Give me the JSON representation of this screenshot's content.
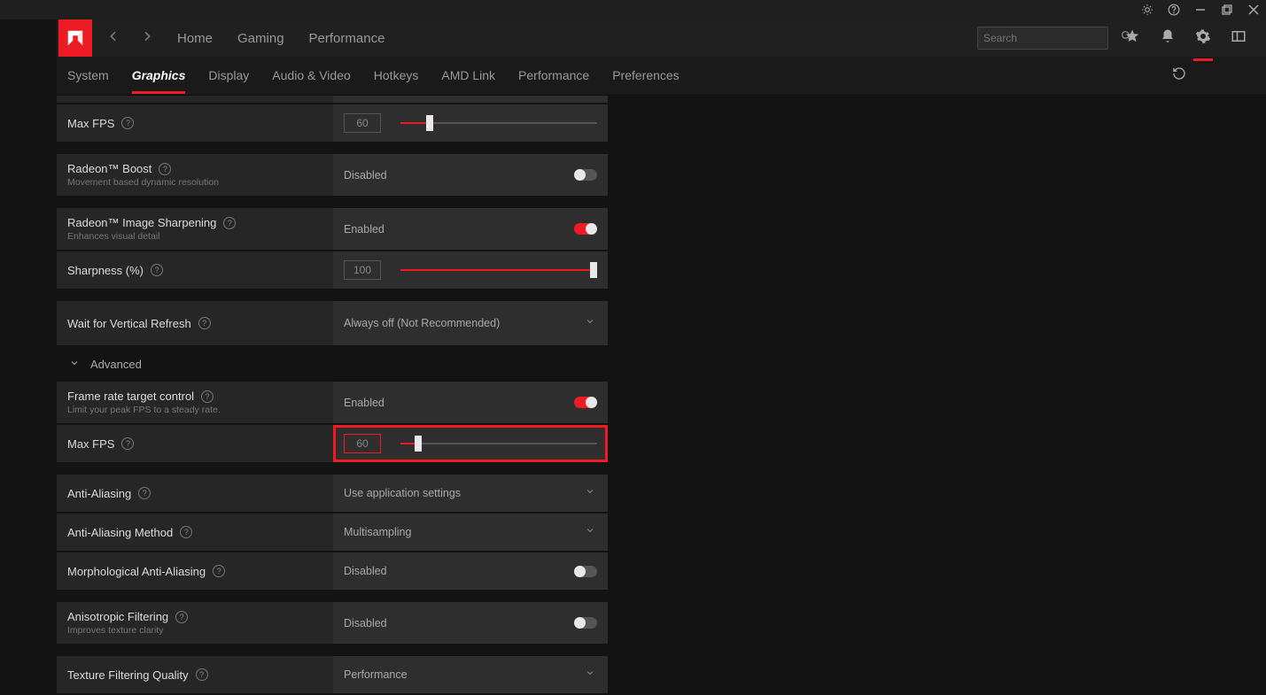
{
  "titlebar": {},
  "header": {
    "nav": {
      "home": "Home",
      "gaming": "Gaming",
      "performance": "Performance"
    },
    "search_placeholder": "Search"
  },
  "subtabs": {
    "system": "System",
    "graphics": "Graphics",
    "display": "Display",
    "av": "Audio & Video",
    "hotkeys": "Hotkeys",
    "amdlink": "AMD Link",
    "performance": "Performance",
    "preferences": "Preferences"
  },
  "rows": {
    "maxfps1": {
      "label": "Max FPS",
      "value": "60"
    },
    "boost": {
      "label": "Radeon™ Boost",
      "sub": "Movement based dynamic resolution",
      "value": "Disabled"
    },
    "sharpen": {
      "label": "Radeon™ Image Sharpening",
      "sub": "Enhances visual detail",
      "value": "Enabled"
    },
    "sharpness": {
      "label": "Sharpness (%)",
      "value": "100"
    },
    "vsync": {
      "label": "Wait for Vertical Refresh",
      "value": "Always off (Not Recommended)"
    },
    "advanced": "Advanced",
    "frtc": {
      "label": "Frame rate target control",
      "sub": "Limit your peak FPS to a steady rate.",
      "value": "Enabled"
    },
    "maxfps2": {
      "label": "Max FPS",
      "value": "60"
    },
    "aa": {
      "label": "Anti-Aliasing",
      "value": "Use application settings"
    },
    "aamethod": {
      "label": "Anti-Aliasing Method",
      "value": "Multisampling"
    },
    "morph": {
      "label": "Morphological Anti-Aliasing",
      "value": "Disabled"
    },
    "aniso": {
      "label": "Anisotropic Filtering",
      "sub": "Improves texture clarity",
      "value": "Disabled"
    },
    "tfq": {
      "label": "Texture Filtering Quality",
      "value": "Performance"
    }
  }
}
